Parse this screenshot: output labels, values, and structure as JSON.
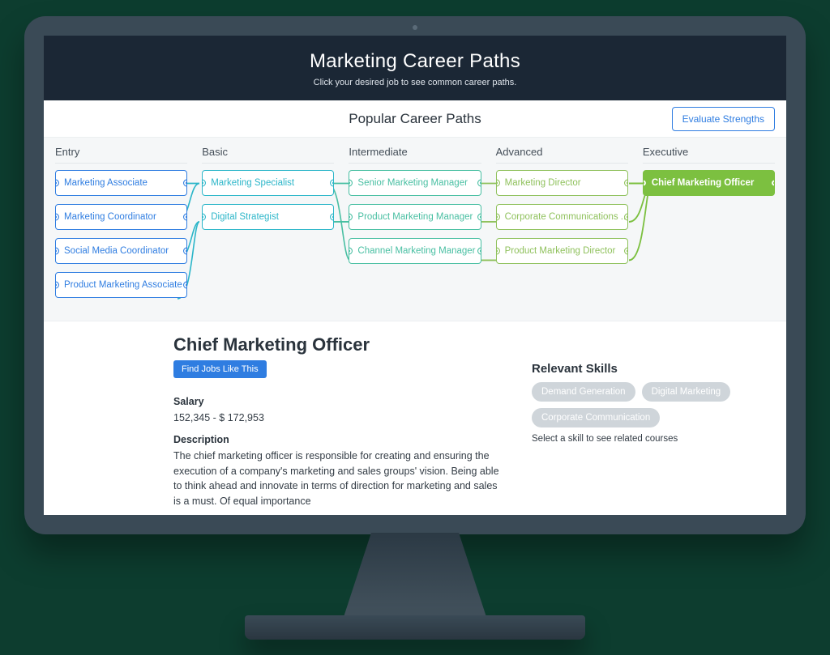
{
  "hero": {
    "title": "Marketing Career Paths",
    "subtitle": "Click your desired job to see common career paths."
  },
  "section_title": "Popular Career Paths",
  "evaluate_btn": "Evaluate Strengths",
  "columns": {
    "entry": {
      "title": "Entry",
      "items": [
        "Marketing Associate",
        "Marketing Coordinator",
        "Social Media Coordinator",
        "Product Marketing Associate"
      ]
    },
    "basic": {
      "title": "Basic",
      "items": [
        "Marketing Specialist",
        "Digital Strategist"
      ]
    },
    "inter": {
      "title": "Intermediate",
      "items": [
        "Senior Marketing Manager",
        "Product Marketing Manager",
        "Channel Marketing Manager"
      ]
    },
    "adv": {
      "title": "Advanced",
      "items": [
        "Marketing Director",
        "Corporate Communications ...",
        "Product Marketing Director"
      ]
    },
    "exec": {
      "title": "Executive",
      "items": [
        "Chief Marketing Officer"
      ]
    }
  },
  "detail": {
    "title": "Chief Marketing Officer",
    "find_btn": "Find Jobs Like This",
    "salary_label": "Salary",
    "salary_value": "152,345 - $ 172,953",
    "description_label": "Description",
    "description": "The chief marketing officer is responsible for creating and ensuring the execution of a company's marketing and sales groups' vision. Being able to think ahead and innovate in terms of direction for marketing and sales is a must. Of equal importance",
    "skills_title": "Relevant Skills",
    "skills": [
      "Demand Generation",
      "Digital Marketing",
      "Corporate Communication"
    ],
    "skills_hint": "Select a skill to see related courses"
  }
}
